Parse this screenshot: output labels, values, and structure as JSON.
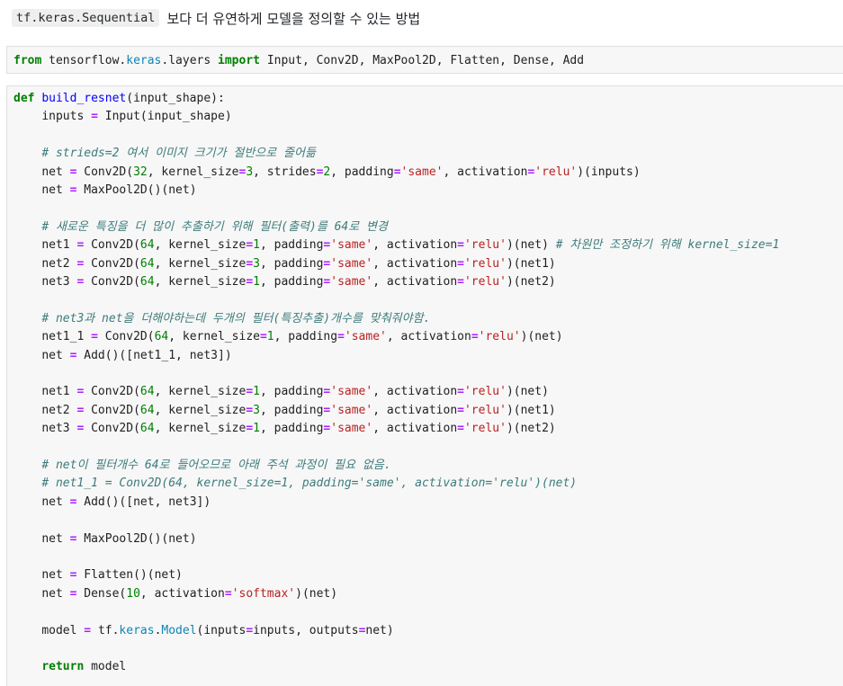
{
  "heading": {
    "code": "tf.keras.Sequential",
    "text": "보다 더 유연하게 모델을 정의할 수 있는 방법"
  },
  "cells": [
    {
      "lines": [
        "from tensorflow.keras.layers import Input, Conv2D, MaxPool2D, Flatten, Dense, Add"
      ]
    },
    {
      "lines": [
        "def build_resnet(input_shape):",
        "    inputs = Input(input_shape)",
        "",
        "    # strieds=2 여서 이미지 크기가 절반으로 줄어듦",
        "    net = Conv2D(32, kernel_size=3, strides=2, padding='same', activation='relu')(inputs)",
        "    net = MaxPool2D()(net)",
        "",
        "    # 새로운 특징을 더 많이 추출하기 위해 필터(출력)를 64로 변경",
        "    net1 = Conv2D(64, kernel_size=1, padding='same', activation='relu')(net) # 차원만 조정하기 위해 kernel_size=1",
        "    net2 = Conv2D(64, kernel_size=3, padding='same', activation='relu')(net1)",
        "    net3 = Conv2D(64, kernel_size=1, padding='same', activation='relu')(net2)",
        "",
        "    # net3과 net을 더해야하는데 두개의 필터(특징추출)개수를 맞춰줘야함.",
        "    net1_1 = Conv2D(64, kernel_size=1, padding='same', activation='relu')(net)",
        "    net = Add()([net1_1, net3])",
        "",
        "    net1 = Conv2D(64, kernel_size=1, padding='same', activation='relu')(net)",
        "    net2 = Conv2D(64, kernel_size=3, padding='same', activation='relu')(net1)",
        "    net3 = Conv2D(64, kernel_size=1, padding='same', activation='relu')(net2)",
        "",
        "    # net이 필터개수 64로 들어오므로 아래 주석 과정이 필요 없음.",
        "    # net1_1 = Conv2D(64, kernel_size=1, padding='same', activation='relu')(net)",
        "    net = Add()([net, net3])",
        "",
        "    net = MaxPool2D()(net)",
        "",
        "    net = Flatten()(net)",
        "    net = Dense(10, activation='softmax')(net)",
        "",
        "    model = tf.keras.Model(inputs=inputs, outputs=net)",
        "",
        "    return model"
      ]
    }
  ],
  "colors": {
    "keyword": "#008000",
    "function": "#0000ff",
    "operator": "#aa22ff",
    "number": "#008000",
    "string": "#ba2121",
    "comment": "#3d7b7b",
    "attribute": "#0e84b5",
    "cell_background": "#f7f7f7"
  }
}
